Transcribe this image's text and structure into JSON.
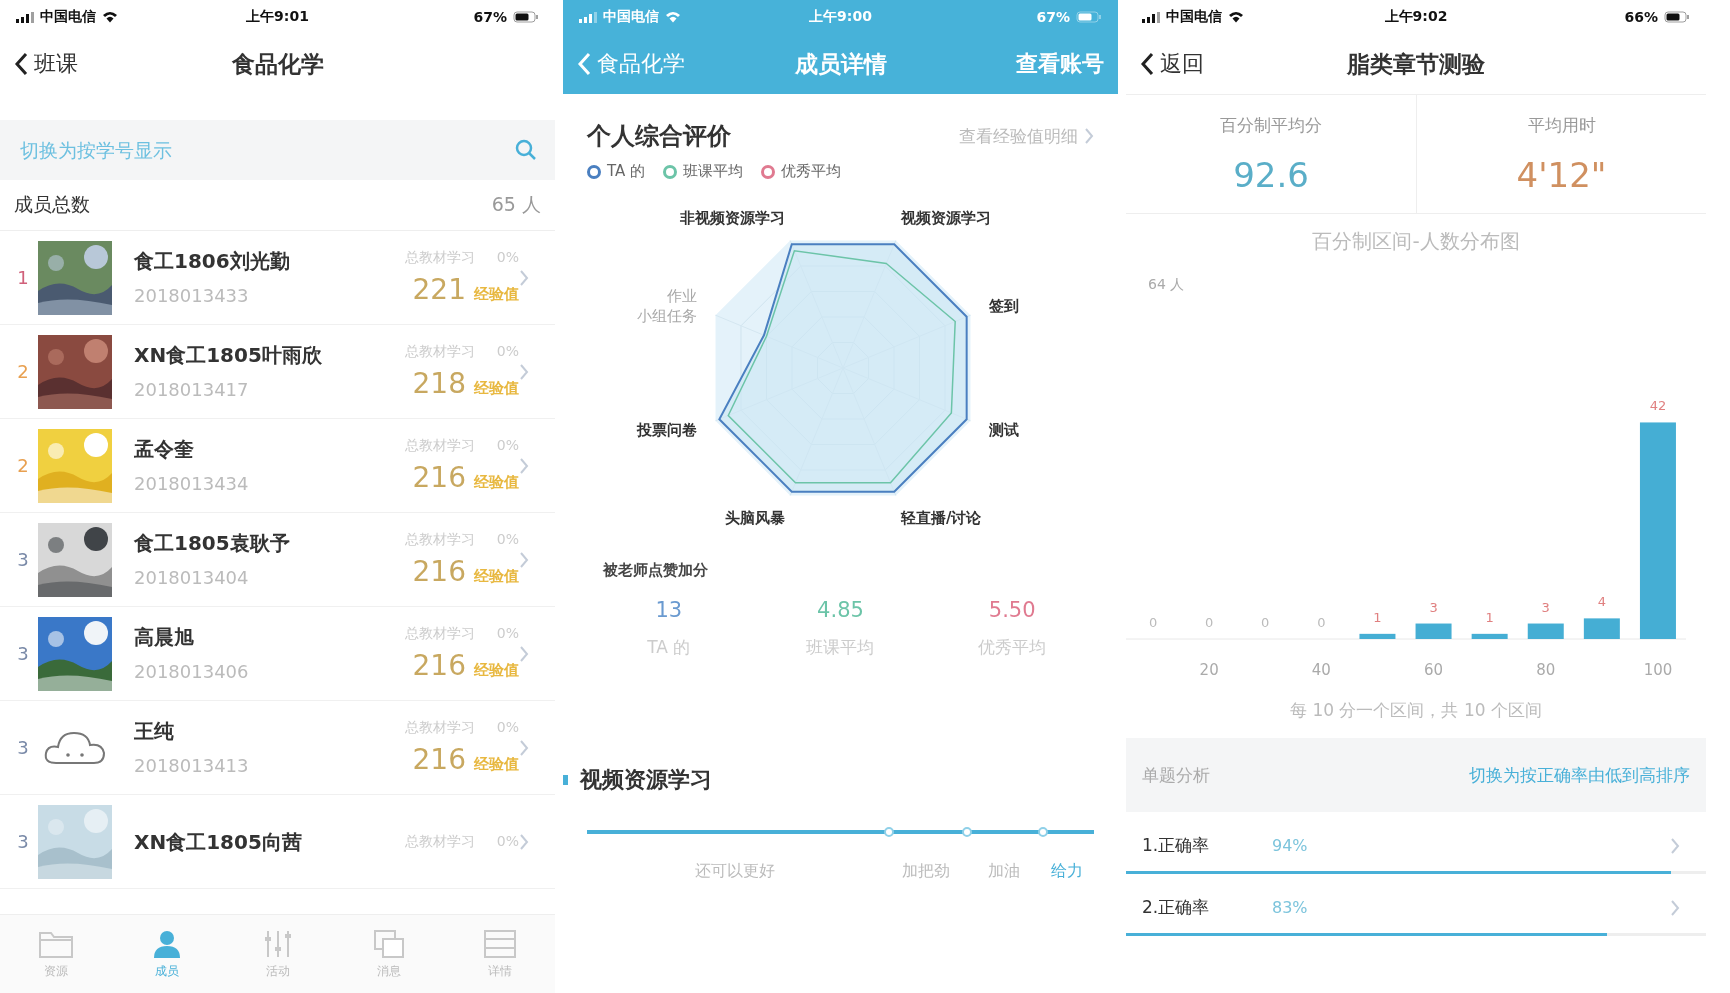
{
  "screens": [
    {
      "status_bar": {
        "carrier": "中国电信",
        "time": "上午9:01",
        "battery": "67%"
      },
      "nav": {
        "back": "班课",
        "title": "食品化学"
      },
      "search": {
        "placeholder": "切换为按学号显示"
      },
      "summary": {
        "label": "成员总数",
        "value": "65 人"
      },
      "members": [
        {
          "rank": "1",
          "color": "#d0607a",
          "kind": "picture",
          "name": "食工1806刘光勤",
          "id": "2018013433",
          "study": "总教材学习",
          "percent": "0%",
          "score": "221",
          "score_label": "经验值"
        },
        {
          "rank": "2",
          "color": "#e8a050",
          "kind": "picture",
          "name": "XN食工1805叶雨欣",
          "id": "2018013417",
          "study": "总教材学习",
          "percent": "0%",
          "score": "218",
          "score_label": "经验值"
        },
        {
          "rank": "2",
          "color": "#e8a050",
          "kind": "picture",
          "name": "孟令奎",
          "id": "2018013434",
          "study": "总教材学习",
          "percent": "0%",
          "score": "216",
          "score_label": "经验值"
        },
        {
          "rank": "3",
          "color": "#7a8aa8",
          "kind": "picture",
          "name": "食工1805袁耿予",
          "id": "2018013404",
          "study": "总教材学习",
          "percent": "0%",
          "score": "216",
          "score_label": "经验值"
        },
        {
          "rank": "3",
          "color": "#7a8aa8",
          "kind": "picture",
          "name": "高晨旭",
          "id": "2018013406",
          "study": "总教材学习",
          "percent": "0%",
          "score": "216",
          "score_label": "经验值"
        },
        {
          "rank": "3",
          "color": "#7a8aa8",
          "kind": "cloud",
          "name": "王纯",
          "id": "2018013413",
          "study": "总教材学习",
          "percent": "0%",
          "score": "216",
          "score_label": "经验值"
        },
        {
          "rank": "3",
          "color": "#7a8aa8",
          "kind": "picture",
          "name": "XN食工1805向茜",
          "study": "总教材学习",
          "percent": "0%"
        }
      ],
      "tabs": [
        {
          "label": "资源",
          "selected": false
        },
        {
          "label": "成员",
          "selected": true
        },
        {
          "label": "活动",
          "selected": false
        },
        {
          "label": "消息",
          "selected": false
        },
        {
          "label": "详情",
          "selected": false
        }
      ]
    },
    {
      "status_bar": {
        "carrier": "中国电信",
        "time": "上午9:00",
        "battery": "67%"
      },
      "nav": {
        "back": "食品化学",
        "title": "成员详情",
        "action": "查看账号"
      },
      "section_title": "个人综合评价",
      "detail_link": "查看经验值明细",
      "legend": [
        {
          "label": "TA 的",
          "color": "#4a7fc0"
        },
        {
          "label": "班课平均",
          "color": "#6cc4a8"
        },
        {
          "label": "优秀平均",
          "color": "#e07a90"
        }
      ],
      "radar_axes": [
        {
          "lines": [
            "视频资源学习"
          ],
          "muted": false
        },
        {
          "lines": [
            "签到"
          ],
          "muted": false
        },
        {
          "lines": [
            "测试"
          ],
          "muted": false
        },
        {
          "lines": [
            "轻直播/讨论"
          ],
          "muted": false
        },
        {
          "lines": [
            "头脑风暴"
          ],
          "muted": false
        },
        {
          "lines": [
            "投票问卷"
          ],
          "muted": false
        },
        {
          "lines": [
            "作业",
            "小组任务"
          ],
          "muted": true
        },
        {
          "lines": [
            "非视频资源学习"
          ],
          "muted": false
        }
      ],
      "likes_title": "被老师点赞加分",
      "likes": [
        {
          "value": "13",
          "label": "TA 的",
          "color": "#6a9ad0"
        },
        {
          "value": "4.85",
          "label": "班课平均",
          "color": "#6cc4a8"
        },
        {
          "value": "5.50",
          "label": "优秀平均",
          "color": "#e07a90"
        }
      ],
      "video_section": "视频资源学习",
      "video_levels": [
        {
          "label": "还可以更好",
          "selected": false
        },
        {
          "label": "加把劲",
          "selected": false
        },
        {
          "label": "加油",
          "selected": false
        },
        {
          "label": "给力",
          "selected": true
        }
      ]
    },
    {
      "status_bar": {
        "carrier": "中国电信",
        "time": "上午9:02",
        "battery": "66%"
      },
      "nav": {
        "back": "返回",
        "title": "脂类章节测验"
      },
      "stats": [
        {
          "label": "百分制平均分",
          "value": "92.6",
          "color": "#5aaec8"
        },
        {
          "label": "平均用时",
          "value": "4'12\"",
          "color": "#d09060"
        }
      ],
      "chart_data": {
        "type": "bar",
        "title": "百分制区间-人数分布图",
        "x": [
          10,
          20,
          30,
          40,
          50,
          60,
          70,
          80,
          90,
          100
        ],
        "series": [
          {
            "color": "#45aed4",
            "values": [
              0,
              0,
              0,
              0,
              1,
              3,
              1,
              3,
              4,
              42
            ]
          }
        ],
        "xlim": [
          5,
          105
        ],
        "ylim": [
          0,
          64
        ],
        "xticks": [
          20,
          40,
          60,
          80,
          100
        ],
        "data_labels": true,
        "annotations": [
          "64 人"
        ]
      },
      "caption": "每 10 分一个区间，共 10 个区间",
      "analysis": {
        "label": "单题分析",
        "sort_link": "切换为按正确率由低到高排序"
      },
      "questions": [
        {
          "label": "1.正确率",
          "value": "94%",
          "level": 0.94
        },
        {
          "label": "2.正确率",
          "value": "83%",
          "level": 0.83
        }
      ]
    }
  ]
}
